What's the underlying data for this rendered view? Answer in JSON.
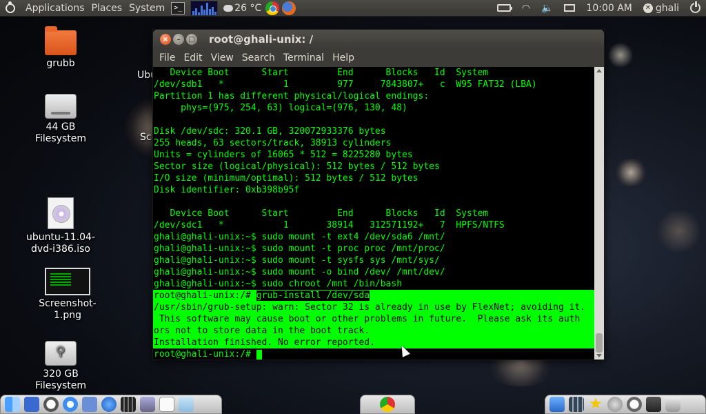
{
  "top_panel": {
    "menus": [
      "Applications",
      "Places",
      "System"
    ],
    "weather": "26 °C",
    "clock": "10:00 AM",
    "user": "ghali"
  },
  "desktop_icons": [
    {
      "label": "grubb",
      "icon": "folder-icon"
    },
    {
      "label": "44 GB Filesystem",
      "icon": "drive-icon"
    },
    {
      "label": "ubuntu-11.04-dvd-i386.iso",
      "icon": "disc-image-icon"
    },
    {
      "label": "Screenshot-1.png",
      "icon": "image-file-icon"
    },
    {
      "label": "320 GB Filesystem",
      "icon": "usb-drive-icon"
    }
  ],
  "behind_labels": [
    "Ubu",
    "Sc"
  ],
  "terminal": {
    "title": "root@ghali-unix: /",
    "menu": [
      "File",
      "Edit",
      "View",
      "Search",
      "Terminal",
      "Help"
    ],
    "lines": [
      "   Device Boot      Start         End      Blocks   Id  System",
      "/dev/sdb1   *           1         977     7843807+   c  W95 FAT32 (LBA)",
      "Partition 1 has different physical/logical endings:",
      "     phys=(975, 254, 63) logical=(976, 130, 48)",
      "",
      "Disk /dev/sdc: 320.1 GB, 320072933376 bytes",
      "255 heads, 63 sectors/track, 38913 cylinders",
      "Units = cylinders of 16065 * 512 = 8225280 bytes",
      "Sector size (logical/physical): 512 bytes / 512 bytes",
      "I/O size (minimum/optimal): 512 bytes / 512 bytes",
      "Disk identifier: 0xb398b95f",
      "",
      "   Device Boot      Start         End      Blocks   Id  System",
      "/dev/sdc1   *           1       38914   312571192+   7  HPFS/NTFS",
      "ghali@ghali-unix:~$ sudo mount -t ext4 /dev/sda6 /mnt/",
      "ghali@ghali-unix:~$ sudo mount -t proc proc /mnt/proc/",
      "ghali@ghali-unix:~$ sudo mount -t sysfs sys /mnt/sys/",
      "ghali@ghali-unix:~$ sudo mount -o bind /dev/ /mnt/dev/",
      "ghali@ghali-unix:~$ sudo chroot /mnt /bin/bash"
    ],
    "highlight_prompt": "root@ghali-unix:/# ",
    "highlight_command": "grub-install /dev/sda",
    "highlighted_lines": [
      "/usr/sbin/grub-setup: warn: Sector 32 is already in use by FlexNet; avoiding it.",
      " This software may cause boot or other problems in future.  Please ask its auth",
      "ors not to store data in the boot track.",
      "Installation finished. No error reported."
    ],
    "final_prompt": "root@ghali-unix:/# "
  },
  "colors": {
    "terminal_text": "#00ff00",
    "terminal_bg": "#000000",
    "panel_bg": "#3a3935",
    "ubuntu_orange": "#dd4814"
  }
}
